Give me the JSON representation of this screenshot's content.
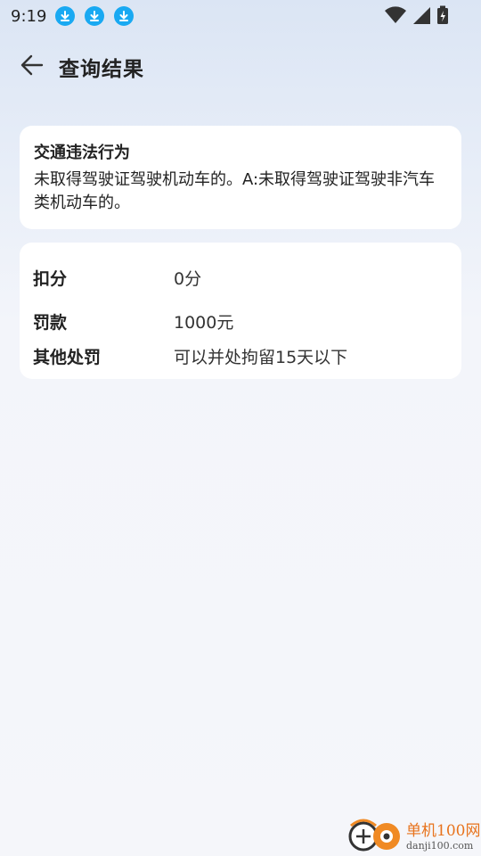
{
  "status_bar": {
    "time": "9:19",
    "notification_icons": [
      "download-icon",
      "download-icon",
      "download-icon"
    ],
    "right_icons": [
      "wifi-icon",
      "cellular-signal-icon",
      "battery-charging-icon"
    ]
  },
  "header": {
    "back_icon": "arrow-left-icon",
    "title": "查询结果"
  },
  "violation_card": {
    "heading": "交通违法行为",
    "description": "未取得驾驶证驾驶机动车的。A:未取得驾驶证驾驶非汽车类机动车的。"
  },
  "penalty_card": {
    "rows": [
      {
        "label": "扣分",
        "value": "0分"
      },
      {
        "label": "罚款",
        "value": "1000元"
      },
      {
        "label": "其他处罚",
        "value": "可以并处拘留15天以下"
      }
    ]
  },
  "watermark": {
    "name": "单机100网",
    "url": "danji100.com"
  },
  "colors": {
    "notification_blue": "#19a9f2",
    "watermark_orange": "#e8731c"
  }
}
